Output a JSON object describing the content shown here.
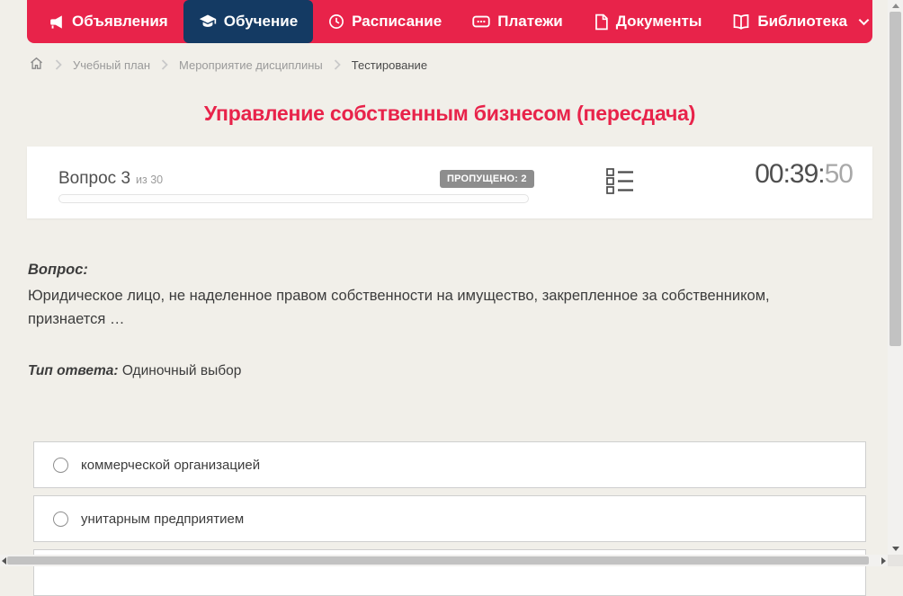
{
  "nav": {
    "items": [
      {
        "label": "Объявления",
        "icon": "megaphone-icon",
        "active": false
      },
      {
        "label": "Обучение",
        "icon": "graduation-cap-icon",
        "active": true
      },
      {
        "label": "Расписание",
        "icon": "clock-icon",
        "active": false
      },
      {
        "label": "Платежи",
        "icon": "wallet-icon",
        "active": false
      },
      {
        "label": "Документы",
        "icon": "document-icon",
        "active": false
      },
      {
        "label": "Библиотека",
        "icon": "book-icon",
        "active": false,
        "has_dropdown": true
      }
    ]
  },
  "breadcrumb": {
    "items": [
      "Учебный план",
      "Мероприятие дисциплины",
      "Тестирование"
    ]
  },
  "page_title": "Управление собственным бизнесом (пересдача)",
  "quiz_header": {
    "question_label": "Вопрос 3",
    "question_of": "из 30",
    "skipped_badge": "ПРОПУЩЕНО: 2",
    "timer_main": "00:39:",
    "timer_seconds": "50",
    "progress_percent": 0
  },
  "question": {
    "label": "Вопрос:",
    "text": "Юридическое лицо, не наделенное правом собственности на имущество, закрепленное за собственником, признается …",
    "answer_type_label": "Тип ответа:",
    "answer_type": "Одиночный выбор",
    "options": [
      "коммерческой организацией",
      "унитарным предприятием"
    ]
  },
  "colors": {
    "accent_red": "#e8234a",
    "accent_navy": "#143a63",
    "page_background": "#f1efe9",
    "badge_gray": "#8d8d8d"
  }
}
